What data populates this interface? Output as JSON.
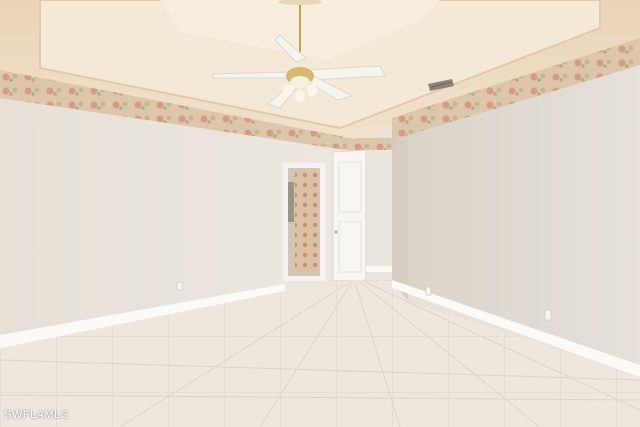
{
  "watermark": {
    "text": "SWFLAMLS"
  },
  "colors": {
    "ceiling": "#efdcc4",
    "ceiling_tray": "#f3e6d3",
    "wall_left": "#e9e4dc",
    "wall_right": "#e2ddd4",
    "wall_back": "#ebe6de",
    "floor": "#ece6dc",
    "baseboard": "#fbfaf7",
    "border_band": "#d9c4a8",
    "border_flower": "#d69d8a",
    "door": "#f7f6f2"
  },
  "icons": [
    "ceiling-fan-icon",
    "air-vent-icon",
    "door-icon",
    "electrical-outlet-icon"
  ]
}
